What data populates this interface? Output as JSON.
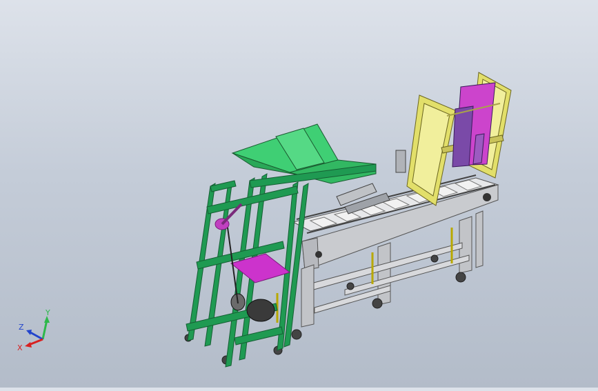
{
  "viewport": {
    "background_top": "#dde2ea",
    "background_bottom": "#b3bcc9",
    "model_colors": {
      "frame_green": "#1f9a52",
      "hopper_green": "#3fcf74",
      "conveyor_gray": "#d4d6da",
      "panel_yellow": "#e2df6a",
      "part_magenta": "#cc33cc",
      "part_purple": "#7a4aa8"
    }
  },
  "triad": {
    "axes": [
      {
        "label": "Y",
        "color": "#2db84a"
      },
      {
        "label": "Z",
        "color": "#2244cc"
      },
      {
        "label": "X",
        "color": "#d82020"
      }
    ]
  }
}
